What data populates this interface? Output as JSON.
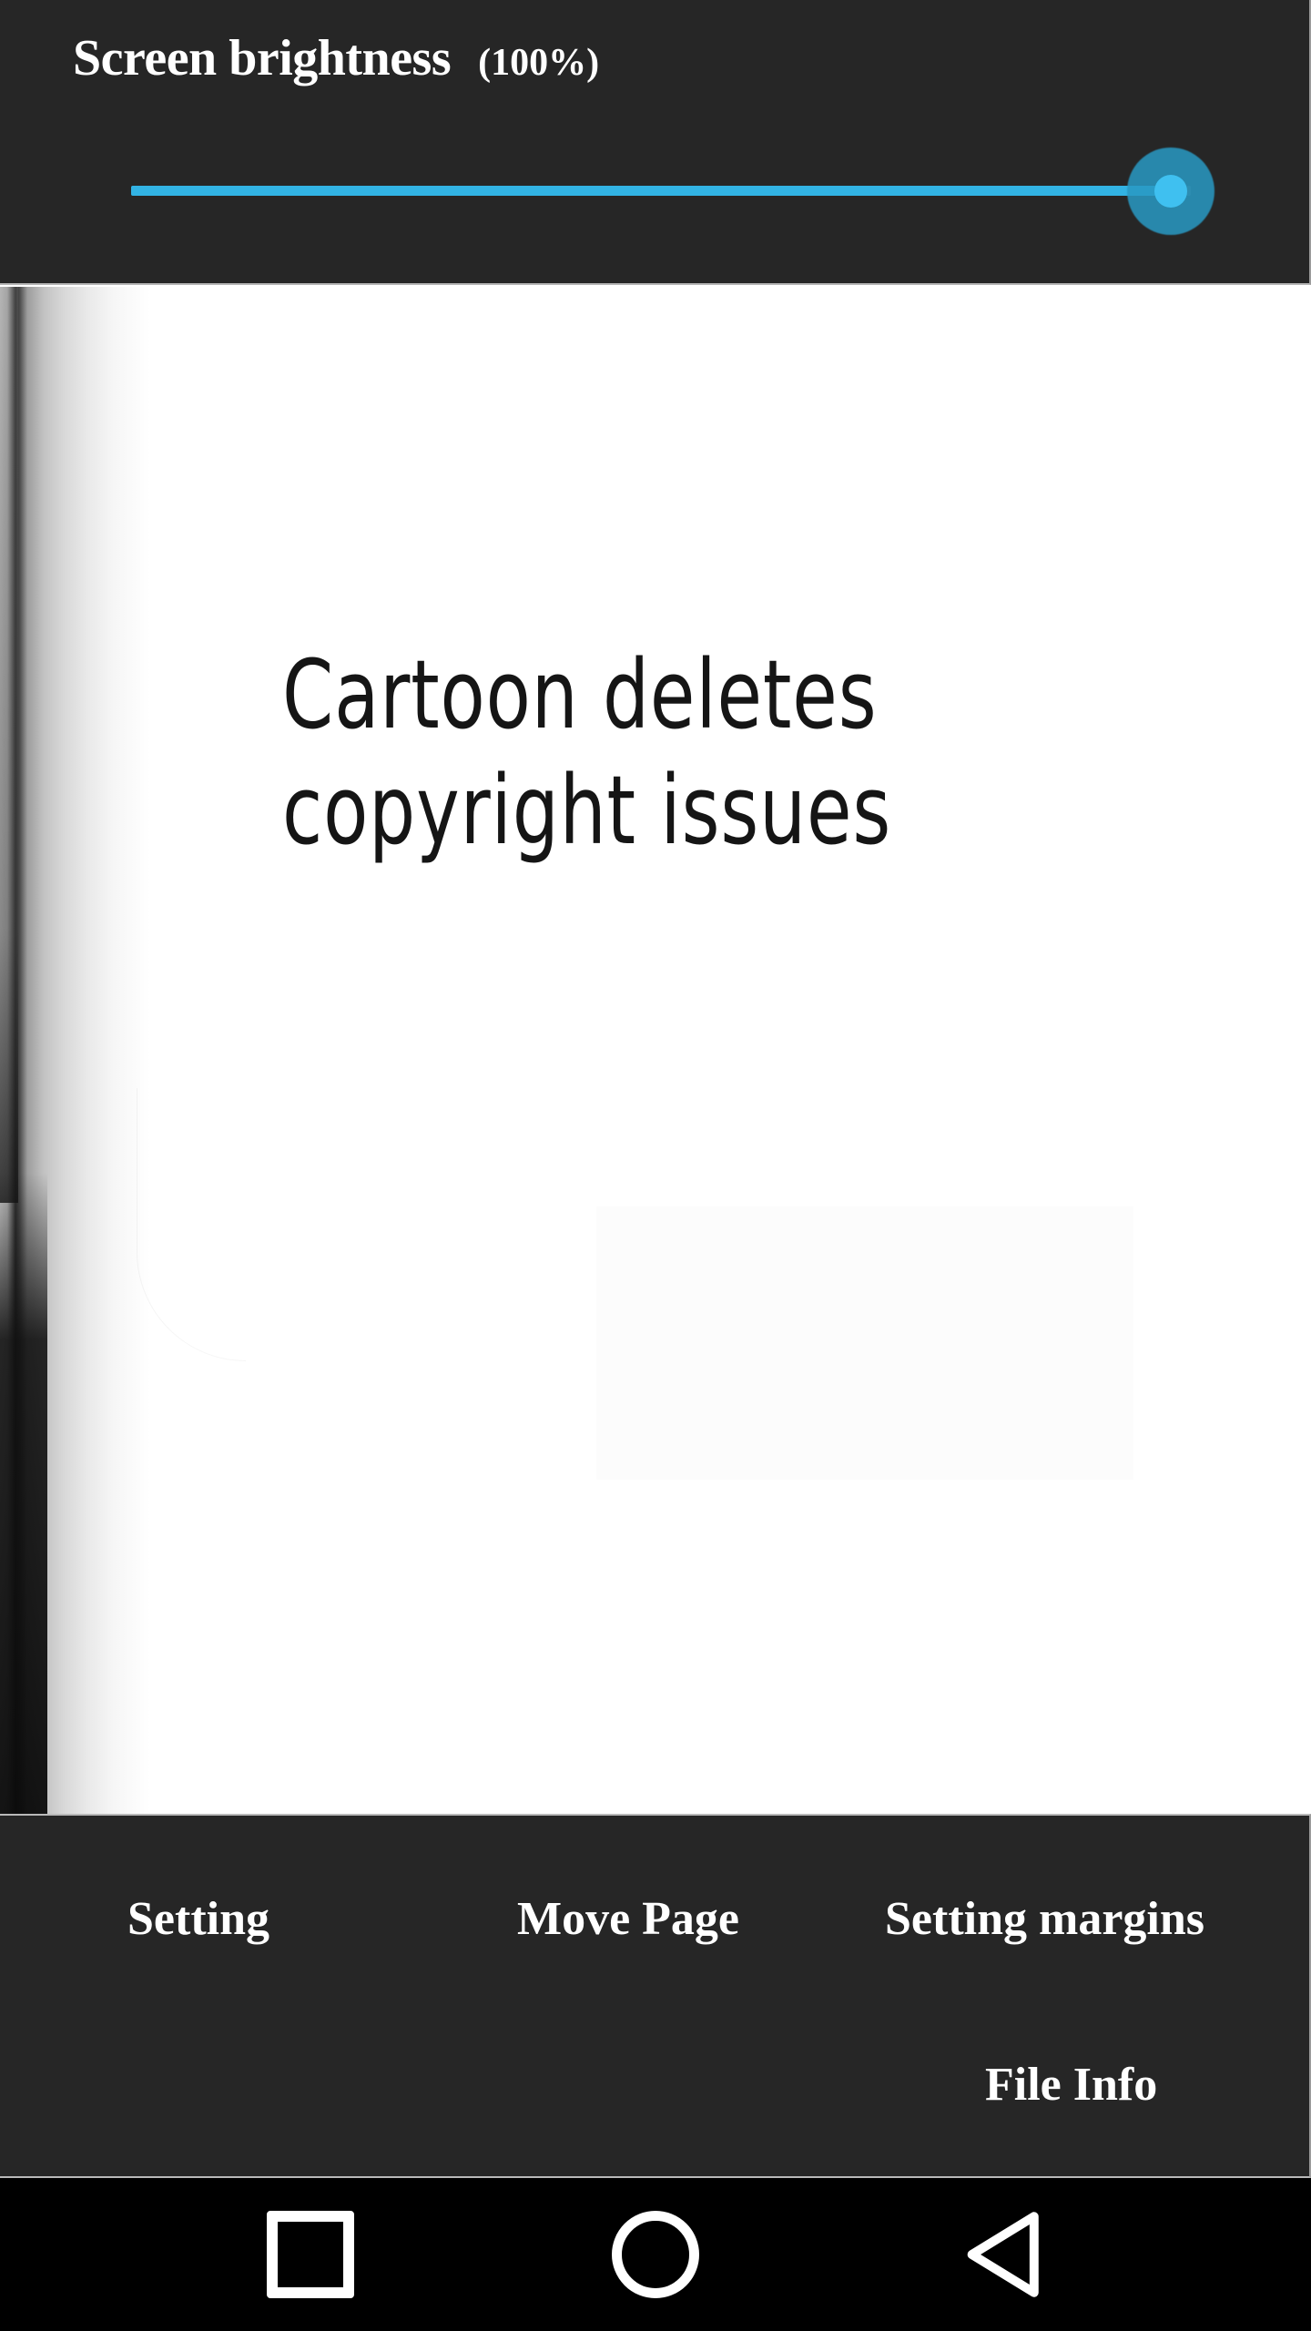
{
  "brightness": {
    "title": "Screen brightness",
    "percent_label": "(100%)",
    "value": 100,
    "min": 0,
    "max": 100,
    "track_color": "#32b3e4",
    "thumb_color": "#3fc0f0",
    "thumb_halo_color": "#2998c3",
    "panel_background": "#262626",
    "text_color": "#ffffff"
  },
  "page": {
    "lines": [
      "Cartoon  deletes",
      "copyright  issues"
    ],
    "background": "#ffffff",
    "text_color": "#151515"
  },
  "menu": {
    "row1": [
      {
        "label": "Setting",
        "name": "setting"
      },
      {
        "label": "Move Page",
        "name": "move-page"
      },
      {
        "label": "Setting margins",
        "name": "setting-margins"
      }
    ],
    "row2": [
      {
        "label": "File Info",
        "name": "file-info"
      }
    ],
    "background": "#262626",
    "text_color": "#ffffff"
  },
  "navbar": {
    "background": "#000000",
    "icon_color": "#ffffff",
    "buttons": [
      {
        "name": "recents-icon",
        "glyph": "square"
      },
      {
        "name": "home-icon",
        "glyph": "circle"
      },
      {
        "name": "back-icon",
        "glyph": "triangle-left"
      }
    ]
  }
}
